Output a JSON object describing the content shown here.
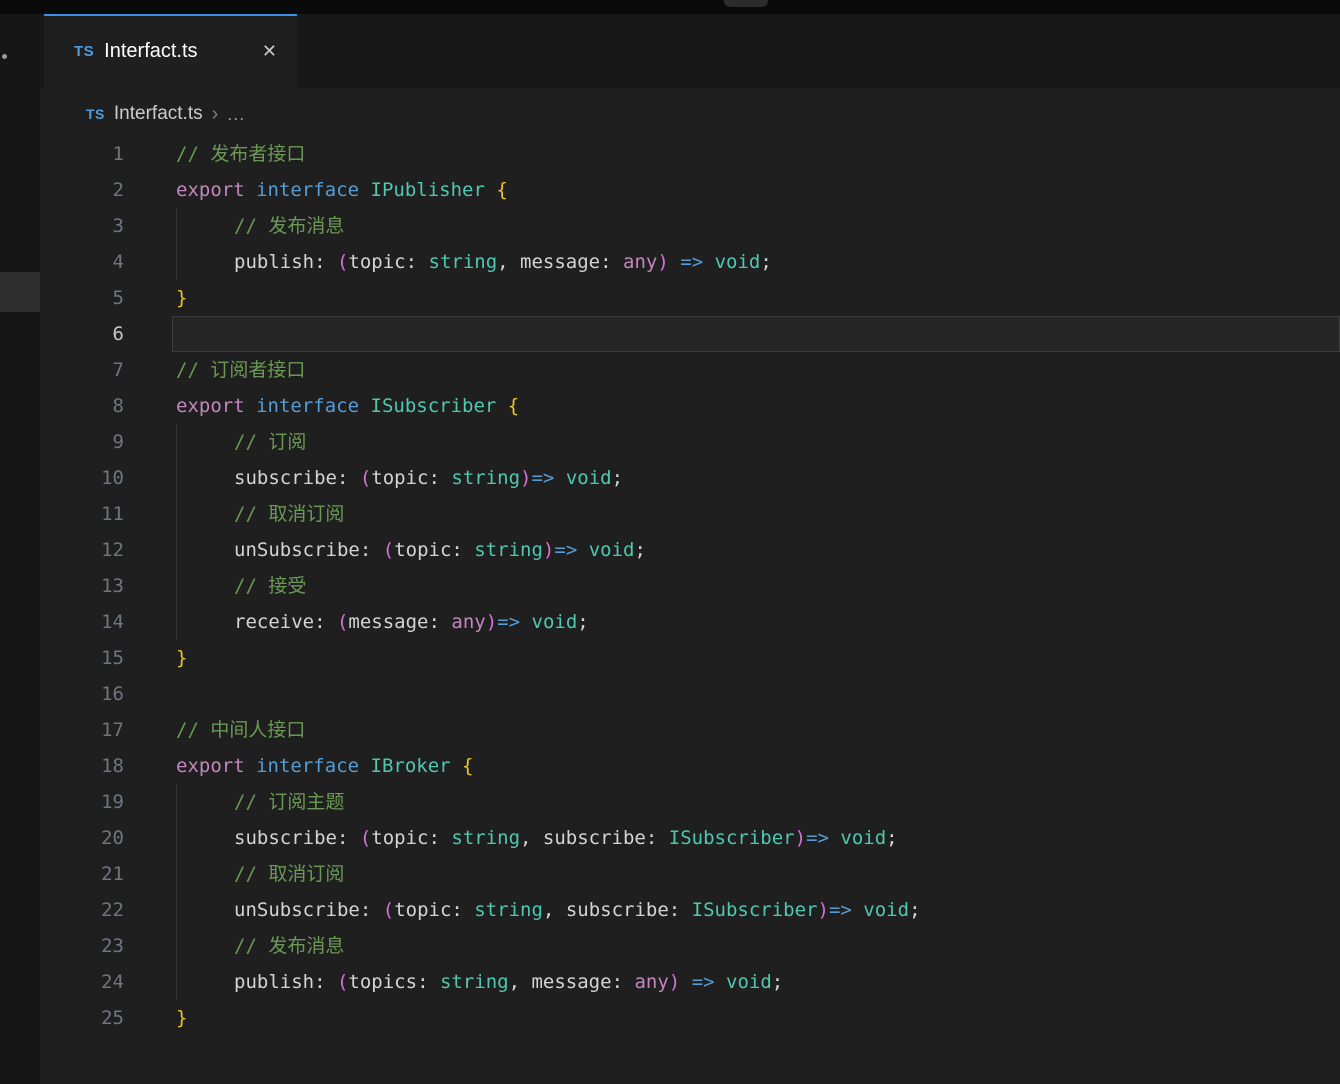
{
  "colors": {
    "bg": "#1f1f1f",
    "topbar": "#0a0a0a",
    "tabbar": "#181818",
    "strip": "#161616",
    "accent": "#3b8eea",
    "ts_blue": "#519ddb",
    "tab_title": "#ffffff",
    "breadcrumb_text": "#cccccc",
    "comment": "#6a9955",
    "kw_pink": "#c586c0",
    "kw_blue": "#569cd6",
    "type_teal": "#4ec9b0",
    "plain": "#d4d4d4",
    "brace": "#e9c62c",
    "paren": "#d670d6",
    "gutter": "#6e7681",
    "gutter_active": "#c6c6c6",
    "linehl_bg": "#262626",
    "linehl_border": "#3d3d3d"
  },
  "tab": {
    "icon_label": "TS",
    "title": "Interfact.ts",
    "close_glyph": "✕"
  },
  "breadcrumb": {
    "icon_label": "TS",
    "file": "Interfact.ts",
    "separator": "›",
    "ellipsis": "..."
  },
  "editor": {
    "current_line": 6,
    "lines": [
      {
        "n": 1,
        "indent": 0,
        "tokens": [
          [
            "// 发布者接口",
            "c"
          ]
        ]
      },
      {
        "n": 2,
        "indent": 0,
        "tokens": [
          [
            "export",
            "k"
          ],
          [
            " ",
            "p"
          ],
          [
            "interface",
            "b"
          ],
          [
            " ",
            "p"
          ],
          [
            "IPublisher",
            "t"
          ],
          [
            " ",
            "p"
          ],
          [
            "{",
            "g"
          ]
        ]
      },
      {
        "n": 3,
        "indent": 1,
        "tokens": [
          [
            "// 发布消息",
            "c"
          ]
        ]
      },
      {
        "n": 4,
        "indent": 1,
        "tokens": [
          [
            "publish",
            "p"
          ],
          [
            ": ",
            "p"
          ],
          [
            "(",
            "o"
          ],
          [
            "topic",
            "p"
          ],
          [
            ": ",
            "p"
          ],
          [
            "string",
            "t"
          ],
          [
            ", ",
            "p"
          ],
          [
            "message",
            "p"
          ],
          [
            ": ",
            "p"
          ],
          [
            "any",
            "k"
          ],
          [
            ")",
            "o"
          ],
          [
            " ",
            "p"
          ],
          [
            "=>",
            "b"
          ],
          [
            " ",
            "p"
          ],
          [
            "void",
            "t"
          ],
          [
            ";",
            "p"
          ]
        ]
      },
      {
        "n": 5,
        "indent": 0,
        "tokens": [
          [
            "}",
            "g"
          ]
        ]
      },
      {
        "n": 6,
        "indent": 0,
        "tokens": []
      },
      {
        "n": 7,
        "indent": 0,
        "tokens": [
          [
            "// 订阅者接口",
            "c"
          ]
        ]
      },
      {
        "n": 8,
        "indent": 0,
        "tokens": [
          [
            "export",
            "k"
          ],
          [
            " ",
            "p"
          ],
          [
            "interface",
            "b"
          ],
          [
            " ",
            "p"
          ],
          [
            "ISubscriber",
            "t"
          ],
          [
            " ",
            "p"
          ],
          [
            "{",
            "g"
          ]
        ]
      },
      {
        "n": 9,
        "indent": 1,
        "tokens": [
          [
            "// 订阅",
            "c"
          ]
        ]
      },
      {
        "n": 10,
        "indent": 1,
        "tokens": [
          [
            "subscribe",
            "p"
          ],
          [
            ": ",
            "p"
          ],
          [
            "(",
            "o"
          ],
          [
            "topic",
            "p"
          ],
          [
            ": ",
            "p"
          ],
          [
            "string",
            "t"
          ],
          [
            ")",
            "o"
          ],
          [
            "=>",
            "b"
          ],
          [
            " ",
            "p"
          ],
          [
            "void",
            "t"
          ],
          [
            ";",
            "p"
          ]
        ]
      },
      {
        "n": 11,
        "indent": 1,
        "tokens": [
          [
            "// 取消订阅",
            "c"
          ]
        ]
      },
      {
        "n": 12,
        "indent": 1,
        "tokens": [
          [
            "unSubscribe",
            "p"
          ],
          [
            ": ",
            "p"
          ],
          [
            "(",
            "o"
          ],
          [
            "topic",
            "p"
          ],
          [
            ": ",
            "p"
          ],
          [
            "string",
            "t"
          ],
          [
            ")",
            "o"
          ],
          [
            "=>",
            "b"
          ],
          [
            " ",
            "p"
          ],
          [
            "void",
            "t"
          ],
          [
            ";",
            "p"
          ]
        ]
      },
      {
        "n": 13,
        "indent": 1,
        "tokens": [
          [
            "// 接受",
            "c"
          ]
        ]
      },
      {
        "n": 14,
        "indent": 1,
        "tokens": [
          [
            "receive",
            "p"
          ],
          [
            ": ",
            "p"
          ],
          [
            "(",
            "o"
          ],
          [
            "message",
            "p"
          ],
          [
            ": ",
            "p"
          ],
          [
            "any",
            "k"
          ],
          [
            ")",
            "o"
          ],
          [
            "=>",
            "b"
          ],
          [
            " ",
            "p"
          ],
          [
            "void",
            "t"
          ],
          [
            ";",
            "p"
          ]
        ]
      },
      {
        "n": 15,
        "indent": 0,
        "tokens": [
          [
            "}",
            "g"
          ]
        ]
      },
      {
        "n": 16,
        "indent": 0,
        "tokens": []
      },
      {
        "n": 17,
        "indent": 0,
        "tokens": [
          [
            "// 中间人接口",
            "c"
          ]
        ]
      },
      {
        "n": 18,
        "indent": 0,
        "tokens": [
          [
            "export",
            "k"
          ],
          [
            " ",
            "p"
          ],
          [
            "interface",
            "b"
          ],
          [
            " ",
            "p"
          ],
          [
            "IBroker",
            "t"
          ],
          [
            " ",
            "p"
          ],
          [
            "{",
            "g"
          ]
        ]
      },
      {
        "n": 19,
        "indent": 1,
        "tokens": [
          [
            "// 订阅主题",
            "c"
          ]
        ]
      },
      {
        "n": 20,
        "indent": 1,
        "tokens": [
          [
            "subscribe",
            "p"
          ],
          [
            ": ",
            "p"
          ],
          [
            "(",
            "o"
          ],
          [
            "topic",
            "p"
          ],
          [
            ": ",
            "p"
          ],
          [
            "string",
            "t"
          ],
          [
            ", ",
            "p"
          ],
          [
            "subscribe",
            "p"
          ],
          [
            ": ",
            "p"
          ],
          [
            "ISubscriber",
            "t"
          ],
          [
            ")",
            "o"
          ],
          [
            "=>",
            "b"
          ],
          [
            " ",
            "p"
          ],
          [
            "void",
            "t"
          ],
          [
            ";",
            "p"
          ]
        ]
      },
      {
        "n": 21,
        "indent": 1,
        "tokens": [
          [
            "// 取消订阅",
            "c"
          ]
        ]
      },
      {
        "n": 22,
        "indent": 1,
        "tokens": [
          [
            "unSubscribe",
            "p"
          ],
          [
            ": ",
            "p"
          ],
          [
            "(",
            "o"
          ],
          [
            "topic",
            "p"
          ],
          [
            ": ",
            "p"
          ],
          [
            "string",
            "t"
          ],
          [
            ", ",
            "p"
          ],
          [
            "subscribe",
            "p"
          ],
          [
            ": ",
            "p"
          ],
          [
            "ISubscriber",
            "t"
          ],
          [
            ")",
            "o"
          ],
          [
            "=>",
            "b"
          ],
          [
            " ",
            "p"
          ],
          [
            "void",
            "t"
          ],
          [
            ";",
            "p"
          ]
        ]
      },
      {
        "n": 23,
        "indent": 1,
        "tokens": [
          [
            "// 发布消息",
            "c"
          ]
        ]
      },
      {
        "n": 24,
        "indent": 1,
        "tokens": [
          [
            "publish",
            "p"
          ],
          [
            ": ",
            "p"
          ],
          [
            "(",
            "o"
          ],
          [
            "topics",
            "p"
          ],
          [
            ": ",
            "p"
          ],
          [
            "string",
            "t"
          ],
          [
            ", ",
            "p"
          ],
          [
            "message",
            "p"
          ],
          [
            ": ",
            "p"
          ],
          [
            "any",
            "k"
          ],
          [
            ")",
            "o"
          ],
          [
            " ",
            "p"
          ],
          [
            "=>",
            "b"
          ],
          [
            " ",
            "p"
          ],
          [
            "void",
            "t"
          ],
          [
            ";",
            "p"
          ]
        ]
      },
      {
        "n": 25,
        "indent": 0,
        "tokens": [
          [
            "}",
            "g"
          ]
        ]
      }
    ]
  }
}
